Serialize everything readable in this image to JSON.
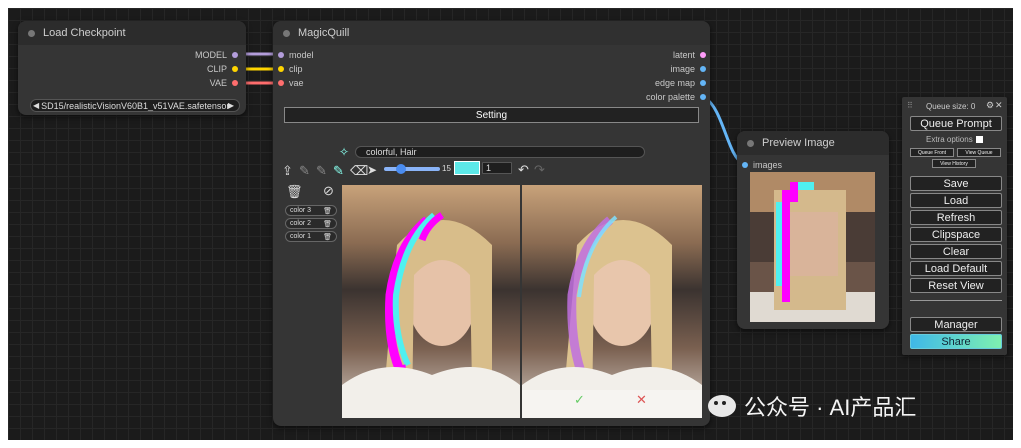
{
  "load_checkpoint": {
    "title": "Load Checkpoint",
    "outputs": [
      "MODEL",
      "CLIP",
      "VAE"
    ],
    "ckpt_value": "SD15/realisticVisionV60B1_v51VAE.safetensors"
  },
  "magicquill": {
    "title": "MagicQuill",
    "inputs": [
      "model",
      "clip",
      "vae"
    ],
    "outputs": [
      "latent",
      "image",
      "edge map",
      "color palette"
    ],
    "setting_label": "Setting",
    "prompt_value": "colorful, Hair",
    "brush_size": "15",
    "opacity_value": "1",
    "color_chips": [
      "color 3",
      "color 2",
      "color 1"
    ]
  },
  "preview": {
    "title": "Preview Image",
    "input": "images"
  },
  "queue_panel": {
    "queue_size": "Queue size: 0",
    "queue_prompt": "Queue Prompt",
    "extra_options": "Extra options",
    "queue_front": "Queue Front",
    "view_queue": "View Queue",
    "view_history": "View History",
    "buttons": [
      "Save",
      "Load",
      "Refresh",
      "Clipspace",
      "Clear",
      "Load Default",
      "Reset View"
    ],
    "manager": "Manager",
    "share": "Share"
  },
  "watermark": "公众号 · AI产品汇",
  "colors": {
    "model": "#b39ddb",
    "clip": "#ffd500",
    "vae": "#ff6e6e",
    "image": "#64b5f6",
    "latent": "#ff9cf9",
    "share": "#5ee0c0"
  }
}
